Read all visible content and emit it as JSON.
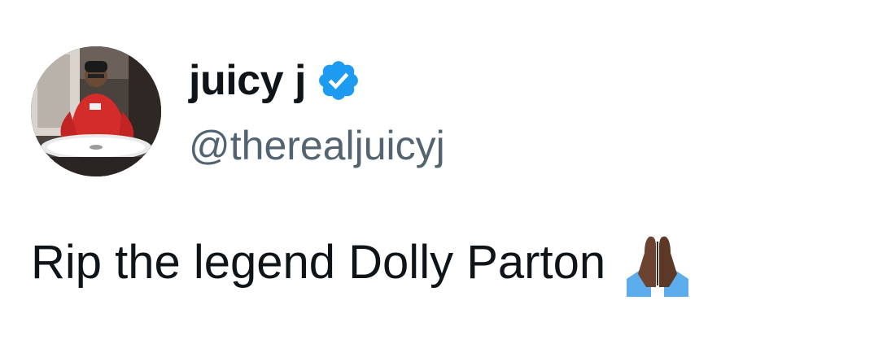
{
  "author": {
    "display_name": "juicy j",
    "handle": "@therealjuicyj",
    "verified": true,
    "avatar_icon": "profile-photo",
    "verified_icon": "verified-badge-icon"
  },
  "tweet": {
    "text": "Rip the legend Dolly Parton",
    "emoji": "folded-hands-emoji"
  },
  "colors": {
    "verified_blue": "#1d9bf0",
    "handle_gray": "#536471",
    "text": "#0f1419"
  }
}
